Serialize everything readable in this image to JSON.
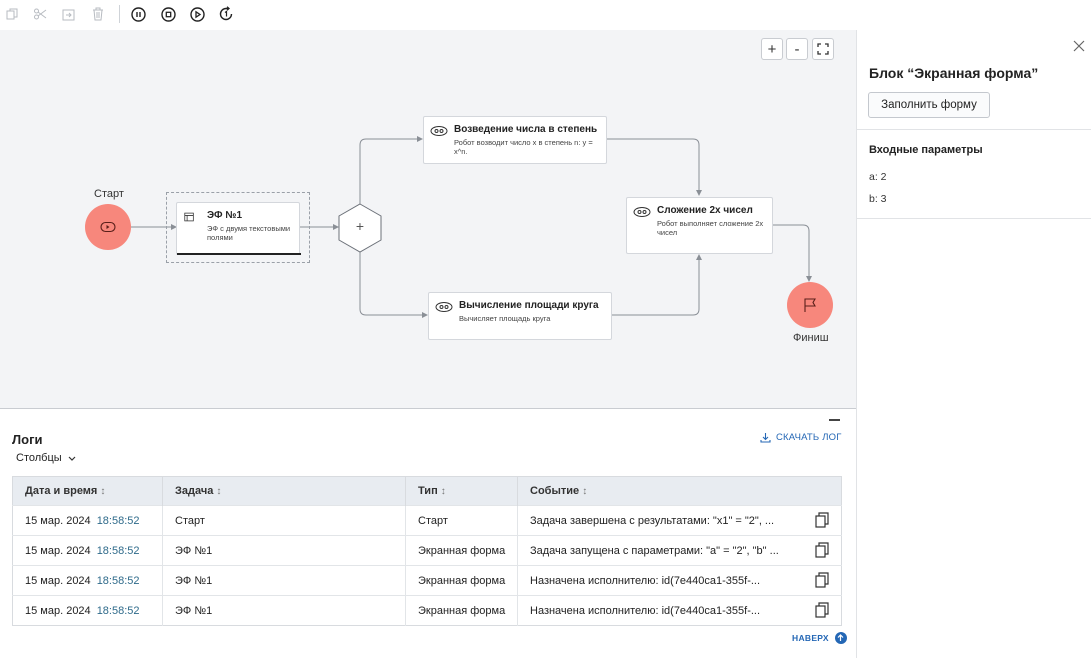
{
  "toolbar": {
    "icons": [
      "copy-icon",
      "cut-icon",
      "paste-icon",
      "delete-icon",
      "pause-icon",
      "stop-icon",
      "run-icon",
      "restart-icon"
    ]
  },
  "canvas": {
    "zoom_in": "+",
    "zoom_out": "-",
    "start": {
      "label": "Старт"
    },
    "finish": {
      "label": "Финиш"
    },
    "tasks": [
      {
        "title": "ЭФ №1",
        "description": "ЭФ с двумя текстовыми полями",
        "icon": "form-icon"
      },
      {
        "title": "Возведение числа в степень",
        "description": "Робот возводит число x в степень n: y = x^n.",
        "icon": "robot-icon"
      },
      {
        "title": "Вычисление площади круга",
        "description": "Вычисляет площадь круга",
        "icon": "robot-icon"
      },
      {
        "title": "Сложение 2х чисел",
        "description": "Робот выполняет сложение 2х чисел",
        "icon": "robot-icon"
      }
    ],
    "gateway": "+"
  },
  "panel": {
    "title": "Блок “Экранная форма”",
    "fill_button": "Заполнить форму",
    "inputs_title": "Входные параметры",
    "params": [
      "a: 2",
      "b: 3"
    ]
  },
  "logs": {
    "title": "Логи",
    "download": "СКАЧАТЬ ЛОГ",
    "columns_button": "Столбцы",
    "headers": [
      "Дата и время",
      "Задача",
      "Тип",
      "Событие"
    ],
    "sort_glyph": "↕",
    "rows": [
      {
        "date": "15 мар. 2024",
        "time": "18:58:52",
        "task": "Старт",
        "type": "Старт",
        "event": "Задача завершена с результатами: \"x1\" = \"2\", ..."
      },
      {
        "date": "15 мар. 2024",
        "time": "18:58:52",
        "task": "ЭФ №1",
        "type": "Экранная форма",
        "event": "Задача запущена с параметрами: \"a\" = \"2\", \"b\" ..."
      },
      {
        "date": "15 мар. 2024",
        "time": "18:58:52",
        "task": "ЭФ №1",
        "type": "Экранная форма",
        "event": "Назначена исполнителю: id(7e440ca1-355f-..."
      },
      {
        "date": "15 мар. 2024",
        "time": "18:58:52",
        "task": "ЭФ №1",
        "type": "Экранная форма",
        "event": "Назначена исполнителю: id(7e440ca1-355f-..."
      }
    ],
    "back_to_top": "НАВЕРХ"
  },
  "colors": {
    "accent": "#2467b5",
    "node_fill": "#f7877c",
    "canvas_bg": "#f3f4f6",
    "header_bg": "#e8ecf1"
  }
}
